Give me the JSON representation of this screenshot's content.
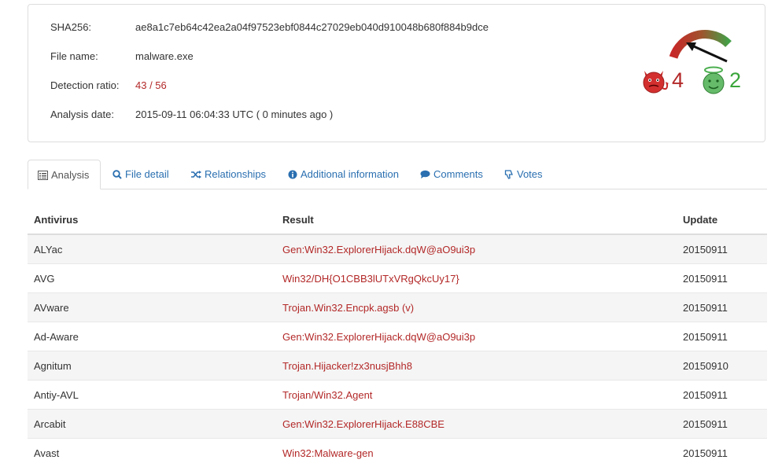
{
  "file": {
    "sha256_label": "SHA256:",
    "sha256": "ae8a1c7eb64c42ea2a04f97523ebf0844c27029eb040d910048b680f884b9dce",
    "filename_label": "File name:",
    "filename": "malware.exe",
    "ratio_label": "Detection ratio:",
    "ratio": "43 / 56",
    "date_label": "Analysis date:",
    "date": "2015-09-11 06:04:33 UTC ( 0 minutes ago )"
  },
  "votes": {
    "malicious": "4",
    "harmless": "2",
    "colors": {
      "malicious": "#b32828",
      "harmless": "#3aa53a"
    },
    "malicious_icon": "devil-icon",
    "harmless_icon": "angel-icon"
  },
  "tabs": [
    {
      "label": "Analysis",
      "icon": "list-icon"
    },
    {
      "label": "File detail",
      "icon": "search-icon"
    },
    {
      "label": "Relationships",
      "icon": "shuffle-icon"
    },
    {
      "label": "Additional information",
      "icon": "info-icon"
    },
    {
      "label": "Comments",
      "icon": "comment-icon"
    },
    {
      "label": "Votes",
      "icon": "thumbs-down-icon"
    }
  ],
  "table": {
    "headers": [
      "Antivirus",
      "Result",
      "Update"
    ],
    "rows": [
      [
        "ALYac",
        "Gen:Win32.ExplorerHijack.dqW@aO9ui3p",
        "20150911"
      ],
      [
        "AVG",
        "Win32/DH{O1CBB3lUTxVRgQkcUy17}",
        "20150911"
      ],
      [
        "AVware",
        "Trojan.Win32.Encpk.agsb (v)",
        "20150911"
      ],
      [
        "Ad-Aware",
        "Gen:Win32.ExplorerHijack.dqW@aO9ui3p",
        "20150911"
      ],
      [
        "Agnitum",
        "Trojan.Hijacker!zx3nusjBhh8",
        "20150910"
      ],
      [
        "Antiy-AVL",
        "Trojan/Win32.Agent",
        "20150911"
      ],
      [
        "Arcabit",
        "Gen:Win32.ExplorerHijack.E88CBE",
        "20150911"
      ],
      [
        "Avast",
        "Win32:Malware-gen",
        "20150911"
      ]
    ]
  }
}
